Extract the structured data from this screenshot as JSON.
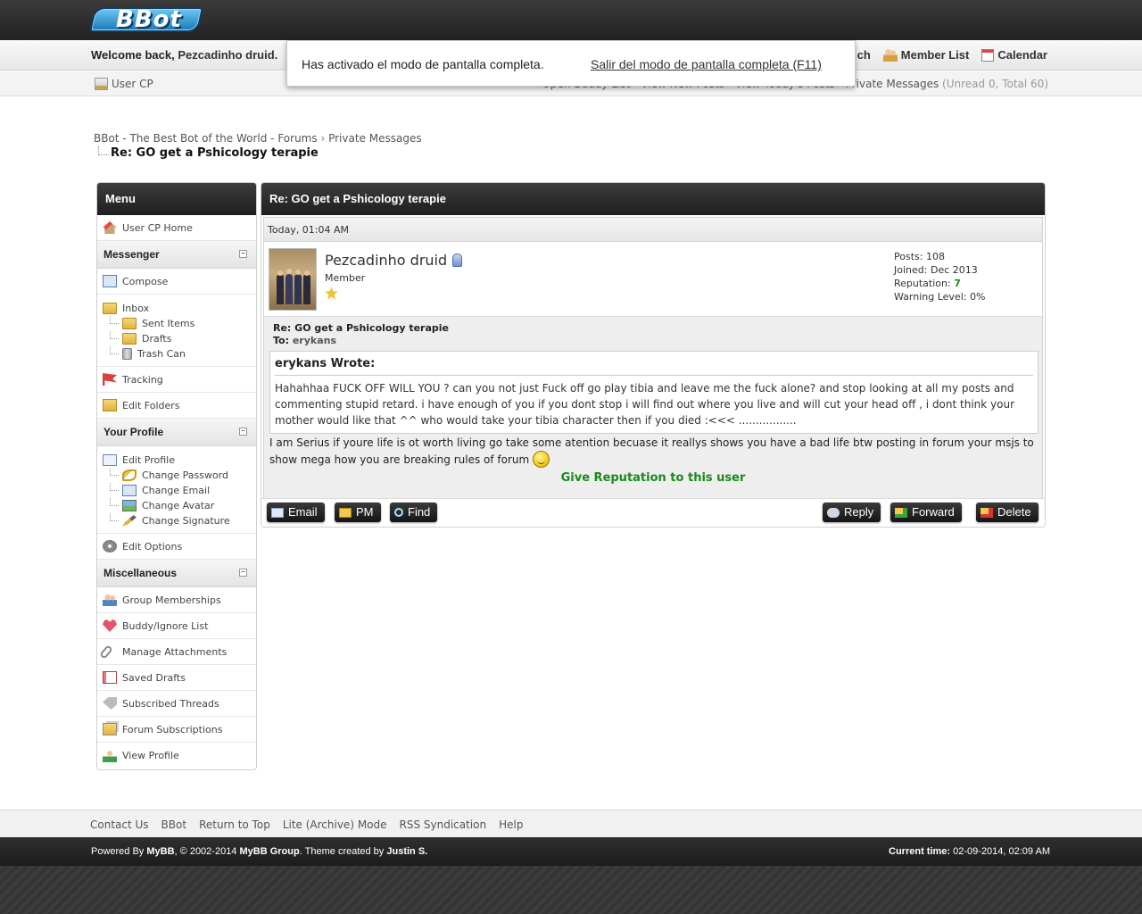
{
  "header": {
    "logo_text": "BBot",
    "welcome_prefix": "Welcome back,",
    "username": "Pezcadinho druid.",
    "overlap_fragment": "ch",
    "member_list": "Member List",
    "calendar": "Calendar"
  },
  "subnav": {
    "user_cp": "User CP",
    "links": [
      "Open Buddy List",
      "View New Posts",
      "View Today's Posts"
    ],
    "private_messages": "Private Messages",
    "pm_counts": "(Unread 0, Total 60)"
  },
  "fullscreen_notice": {
    "message": "Has activado el modo de pantalla completa.",
    "exit_label": "Salir del modo de pantalla completa (F11)"
  },
  "breadcrumb": {
    "items": [
      "BBot - The Best Bot of the World - Forums",
      "Private Messages"
    ],
    "separator": "›",
    "active": "Re: GO get a Pshicology terapie"
  },
  "sidebar": {
    "title": "Menu",
    "home": "User CP Home",
    "messenger": {
      "title": "Messenger",
      "compose": "Compose",
      "inbox": "Inbox",
      "sent": "Sent Items",
      "drafts": "Drafts",
      "trash": "Trash Can",
      "tracking": "Tracking",
      "edit_folders": "Edit Folders"
    },
    "profile": {
      "title": "Your Profile",
      "edit_profile": "Edit Profile",
      "change_password": "Change Password",
      "change_email": "Change Email",
      "change_avatar": "Change Avatar",
      "change_signature": "Change Signature",
      "edit_options": "Edit Options"
    },
    "misc": {
      "title": "Miscellaneous",
      "items": [
        "Group Memberships",
        "Buddy/Ignore List",
        "Manage Attachments",
        "Saved Drafts",
        "Subscribed Threads",
        "Forum Subscriptions",
        "View Profile"
      ],
      "icons": [
        "group-memberships-icon",
        "heart-icon",
        "paperclip-icon",
        "saved-drafts-icon",
        "tag-icon",
        "forum-subscriptions-icon",
        "view-profile-icon"
      ]
    }
  },
  "message": {
    "title": "Re: GO get a Pshicology terapie",
    "date": "Today, 01:04 AM",
    "author": "Pezcadinho druid",
    "rank": "Member",
    "stats": {
      "posts_label": "Posts:",
      "posts": "108",
      "joined_label": "Joined:",
      "joined": "Dec 2013",
      "rep_label": "Reputation:",
      "rep": "7",
      "warn_label": "Warning Level:",
      "warn": "0%"
    },
    "subject": "Re: GO get a Pshicology terapie",
    "to_label": "To:",
    "to": "erykans",
    "quote_header": "erykans Wrote:",
    "quote_text": "Hahahhaa FUCK OFF WILL YOU ? can you not just Fuck off go play tibia and leave me the fuck alone? and stop looking at all my posts and commenting stupid retard. i have enough of you if you dont stop i will find out where you live and will cut your head off , i dont think your mother would like that ^^ who would take your tibia character then if you died :<<< .................",
    "body": "I am Serius if youre life is ot worth living go take some atention becuase it reallys shows you have a bad life btw posting in forum your msjs to show mega how you are breaking rules of forum",
    "give_rep": "Give Reputation to this user",
    "buttons": {
      "email": "Email",
      "pm": "PM",
      "find": "Find",
      "reply": "Reply",
      "forward": "Forward",
      "delete": "Delete"
    }
  },
  "footer": {
    "links": [
      "Contact Us",
      "BBot",
      "Return to Top",
      "Lite (Archive) Mode",
      "RSS Syndication",
      "Help"
    ],
    "powered_by": "Powered By",
    "mybb": "MyBB",
    "copyright_years": ", © 2002-2014",
    "mybb_group": "MyBB Group",
    "theme_by": ". Theme created by",
    "theme_author": "Justin S.",
    "current_time_label": "Current time:",
    "current_time": "02-09-2014, 02:09 AM"
  }
}
